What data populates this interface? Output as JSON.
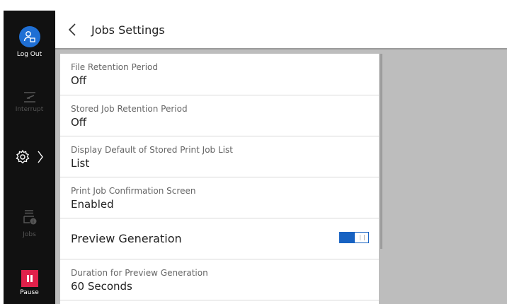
{
  "sidebar": {
    "logout_label": "Log Out",
    "interrupt_label": "Interrupt",
    "jobs_label": "Jobs",
    "pause_label": "Pause"
  },
  "header": {
    "title": "Jobs Settings"
  },
  "settings": [
    {
      "label": "File Retention Period",
      "value": "Off"
    },
    {
      "label": "Stored Job Retention Period",
      "value": "Off"
    },
    {
      "label": "Display Default of Stored Print Job List",
      "value": "List"
    },
    {
      "label": "Print Job Confirmation Screen",
      "value": "Enabled"
    },
    {
      "label": "Preview Generation",
      "toggle_on": true
    },
    {
      "label": "Duration for Preview Generation",
      "value": "60 Seconds"
    }
  ],
  "colors": {
    "accent": "#1762c2",
    "logout_circle": "#1f6fd4",
    "pause": "#e0204a",
    "sidebar_bg": "#111111",
    "content_bg": "#bdbdbd"
  },
  "icons": {
    "logout": "user-logout-icon",
    "interrupt": "interrupt-icon",
    "settings": "gear-icon",
    "jobs": "jobs-icon",
    "pause": "pause-icon",
    "back": "chevron-left-icon"
  }
}
